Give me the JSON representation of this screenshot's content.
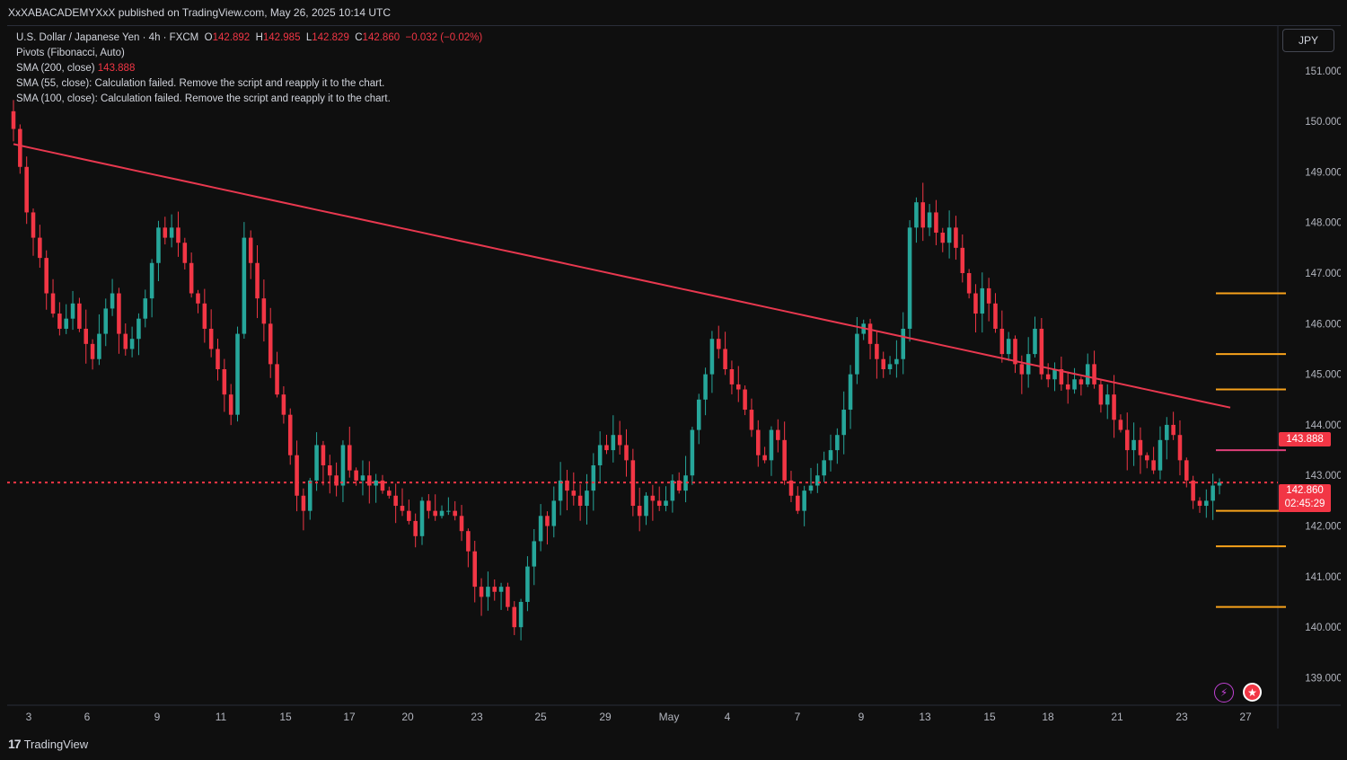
{
  "header": {
    "published_text": "XxXABACADEMYXxX published on TradingView.com, May 26, 2025 10:14 UTC"
  },
  "legend": {
    "symbol_line": "U.S. Dollar / Japanese Yen · 4h · FXCM",
    "o_label": "O",
    "o_value": "142.892",
    "h_label": "H",
    "h_value": "142.985",
    "l_label": "L",
    "l_value": "142.829",
    "c_label": "C",
    "c_value": "142.860",
    "change": "−0.032 (−0.02%)",
    "pivots": "Pivots (Fibonacci, Auto)",
    "sma200_label": "SMA (200, close)",
    "sma200_value": "143.888",
    "sma55_msg": "SMA (55, close): Calculation failed. Remove the script and reapply it to the chart.",
    "sma100_msg": "SMA (100, close): Calculation failed. Remove the script and reapply it to the chart."
  },
  "currency_button": "JPY",
  "price_tags": {
    "sma": "143.888",
    "last": "142.860",
    "countdown": "02:45:29"
  },
  "footer": {
    "brand": "TradingView",
    "logo_glyph": "17"
  },
  "icons": [
    "flash-icon",
    "us-flag-icon"
  ],
  "colors": {
    "up": "#26a69a",
    "down": "#f23645",
    "sma": "#e8384f",
    "pivot": "#f7a21b",
    "pivot_p": "#e0407a",
    "bg": "#0f0f0f"
  },
  "chart_data": {
    "type": "candlestick",
    "symbol": "USDJPY",
    "timeframe": "4h",
    "y_ticks": [
      "151.000",
      "150.000",
      "149.000",
      "148.000",
      "147.000",
      "146.000",
      "145.000",
      "144.000",
      "143.000",
      "142.000",
      "141.000",
      "140.000",
      "139.000"
    ],
    "ylim": [
      138.6,
      151.6
    ],
    "x_ticks": [
      "3",
      "6",
      "9",
      "11",
      "15",
      "17",
      "20",
      "23",
      "25",
      "29",
      "May",
      "4",
      "7",
      "9",
      "13",
      "15",
      "18",
      "21",
      "23",
      "27"
    ],
    "closes": [
      149.85,
      149.1,
      148.2,
      147.7,
      147.3,
      146.6,
      146.2,
      145.9,
      146.1,
      146.4,
      145.9,
      145.6,
      145.3,
      145.8,
      146.3,
      146.6,
      145.8,
      145.5,
      145.7,
      146.1,
      146.5,
      147.2,
      147.9,
      147.7,
      147.9,
      147.6,
      147.2,
      146.6,
      146.4,
      145.9,
      145.5,
      145.1,
      144.6,
      144.2,
      145.8,
      147.7,
      147.2,
      146.5,
      146.0,
      145.2,
      144.6,
      144.2,
      143.4,
      142.6,
      142.3,
      142.9,
      143.6,
      143.2,
      143.0,
      142.8,
      143.6,
      143.1,
      142.9,
      143.0,
      142.8,
      142.9,
      142.7,
      142.6,
      142.4,
      142.3,
      142.1,
      141.8,
      142.5,
      142.3,
      142.2,
      142.3,
      142.3,
      142.2,
      141.9,
      141.5,
      140.8,
      140.6,
      140.8,
      140.7,
      140.8,
      140.4,
      140.0,
      140.5,
      141.2,
      141.7,
      142.2,
      142.0,
      142.5,
      142.9,
      142.7,
      142.6,
      142.4,
      142.7,
      143.2,
      143.6,
      143.5,
      143.8,
      143.6,
      143.3,
      142.4,
      142.2,
      142.6,
      142.5,
      142.4,
      142.5,
      142.9,
      142.7,
      143.0,
      143.9,
      144.5,
      145.0,
      145.7,
      145.5,
      145.1,
      144.8,
      144.7,
      144.3,
      143.9,
      143.4,
      143.3,
      143.9,
      143.7,
      142.9,
      142.6,
      142.3,
      142.7,
      142.8,
      143.0,
      143.3,
      143.5,
      143.8,
      144.3,
      145.0,
      145.8,
      146.0,
      145.6,
      145.3,
      145.1,
      145.2,
      145.3,
      145.9,
      147.9,
      148.4,
      147.9,
      148.2,
      147.8,
      147.6,
      147.9,
      147.5,
      147.0,
      146.6,
      146.2,
      146.7,
      146.4,
      145.9,
      145.4,
      145.7,
      145.2,
      145.0,
      145.4,
      145.9,
      145.0,
      144.9,
      145.1,
      144.8,
      144.7,
      144.9,
      144.8,
      145.2,
      144.8,
      144.4,
      144.6,
      144.1,
      143.9,
      143.5,
      143.7,
      143.4,
      143.3,
      143.1,
      143.7,
      144.0,
      143.8,
      143.3,
      142.9,
      142.5,
      142.4,
      142.5,
      142.8,
      142.86
    ],
    "sma200": {
      "start": 149.55,
      "end": 143.888
    },
    "pivots": [
      146.6,
      145.4,
      144.7,
      143.5,
      142.3,
      141.6,
      140.4
    ],
    "last_price": 142.86
  }
}
